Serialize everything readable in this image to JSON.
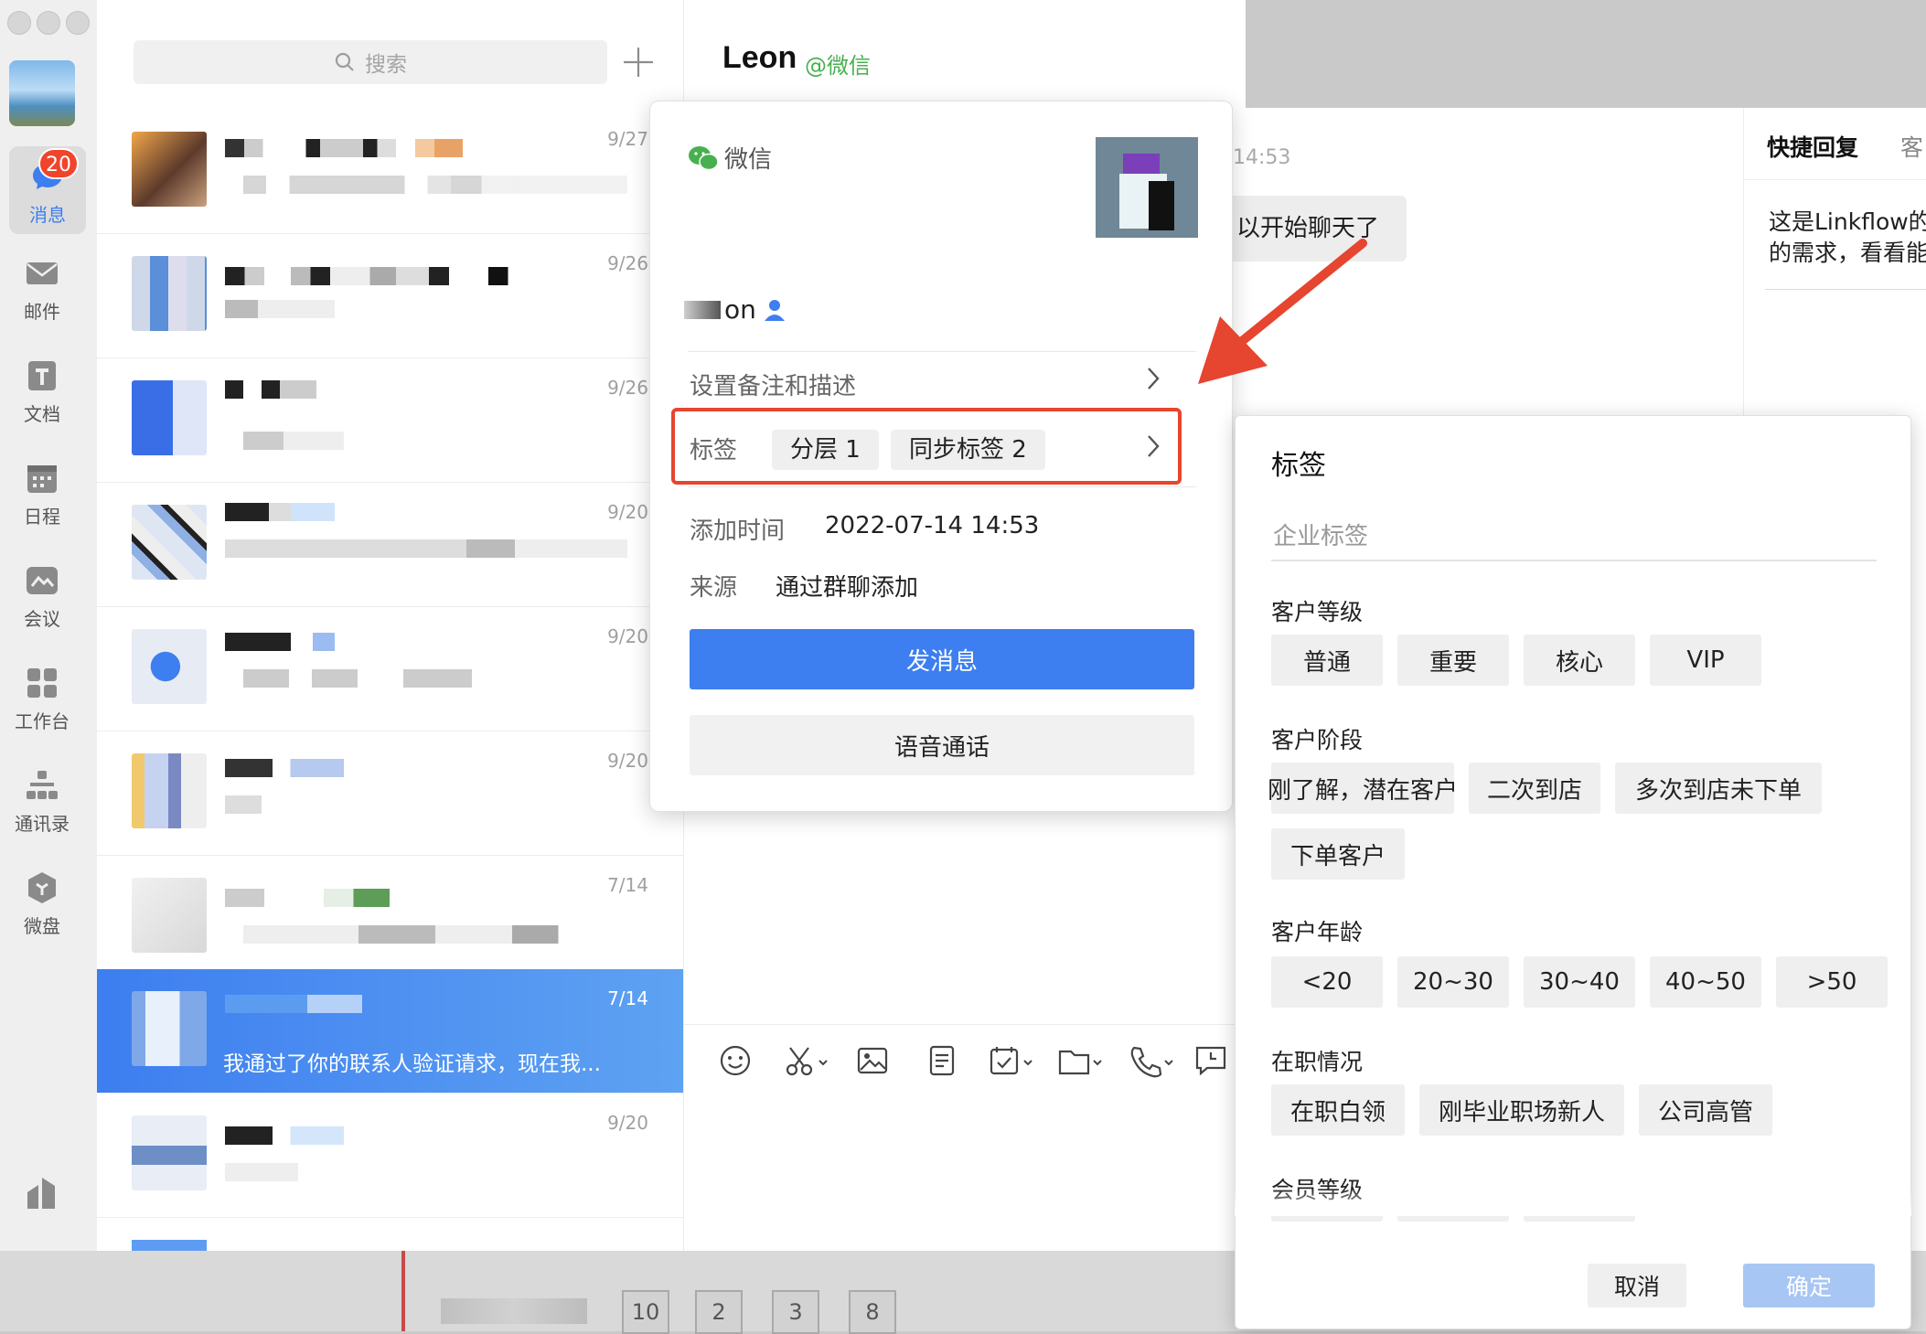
{
  "rail": {
    "badge": "20",
    "items": [
      {
        "label": "消息",
        "icon": "chat-bubble-icon"
      },
      {
        "label": "邮件",
        "icon": "mail-icon"
      },
      {
        "label": "文档",
        "icon": "document-icon"
      },
      {
        "label": "日程",
        "icon": "calendar-icon"
      },
      {
        "label": "会议",
        "icon": "meeting-icon"
      },
      {
        "label": "工作台",
        "icon": "workbench-icon"
      },
      {
        "label": "通讯录",
        "icon": "contacts-icon"
      },
      {
        "label": "微盘",
        "icon": "drive-icon"
      }
    ]
  },
  "list": {
    "search_placeholder": "搜索",
    "conversations": [
      {
        "date": "9/27"
      },
      {
        "date": "9/26"
      },
      {
        "date": "9/26"
      },
      {
        "date": "9/20"
      },
      {
        "date": "9/20"
      },
      {
        "date": "9/20"
      },
      {
        "date": "7/14"
      },
      {
        "date": "7/14",
        "preview": "我通过了你的联系人验证请求，现在我...",
        "selected": true
      },
      {
        "date": "9/20"
      }
    ]
  },
  "chat": {
    "name": "Leon",
    "source_tag": "@微信",
    "time_fragment": "14:53",
    "bubble_fragment": "以开始聊天了"
  },
  "right_panel": {
    "tab_quick_reply": "快捷回复",
    "tab_other": "客",
    "text_line1": "这是Linkflow的",
    "text_line2": "的需求，看看能"
  },
  "contact_card": {
    "platform": "微信",
    "name_fragment": "on",
    "set_remark_label": "设置备注和描述",
    "tags_label": "标签",
    "tags": [
      "分层 1",
      "同步标签 2"
    ],
    "add_time_label": "添加时间",
    "add_time_value": "2022-07-14 14:53",
    "source_label": "来源",
    "source_value": "通过群聊添加",
    "send_message_button": "发消息",
    "voice_call_button": "语音通话"
  },
  "tag_panel": {
    "title": "标签",
    "search_placeholder": "企业标签",
    "groups": [
      {
        "name": "客户等级",
        "tags": [
          "普通",
          "重要",
          "核心",
          "VIP"
        ]
      },
      {
        "name": "客户阶段",
        "tags": [
          "刚了解，潜在客户",
          "二次到店",
          "多次到店未下单",
          "下单客户"
        ]
      },
      {
        "name": "客户年龄",
        "tags": [
          "<20",
          "20~30",
          "30~40",
          "40~50",
          ">50"
        ]
      },
      {
        "name": "在职情况",
        "tags": [
          "在职白领",
          "刚毕业职场新人",
          "公司高管"
        ]
      },
      {
        "name": "会员等级",
        "tags": []
      }
    ],
    "cancel_button": "取消",
    "confirm_button": "确定"
  },
  "background_pager": [
    "10",
    "2",
    "3",
    "8"
  ],
  "colors": {
    "accent_blue": "#3d7ef0",
    "highlight_red": "#e6452f",
    "wechat_green": "#48b04f",
    "badge_red": "#f0442b"
  }
}
